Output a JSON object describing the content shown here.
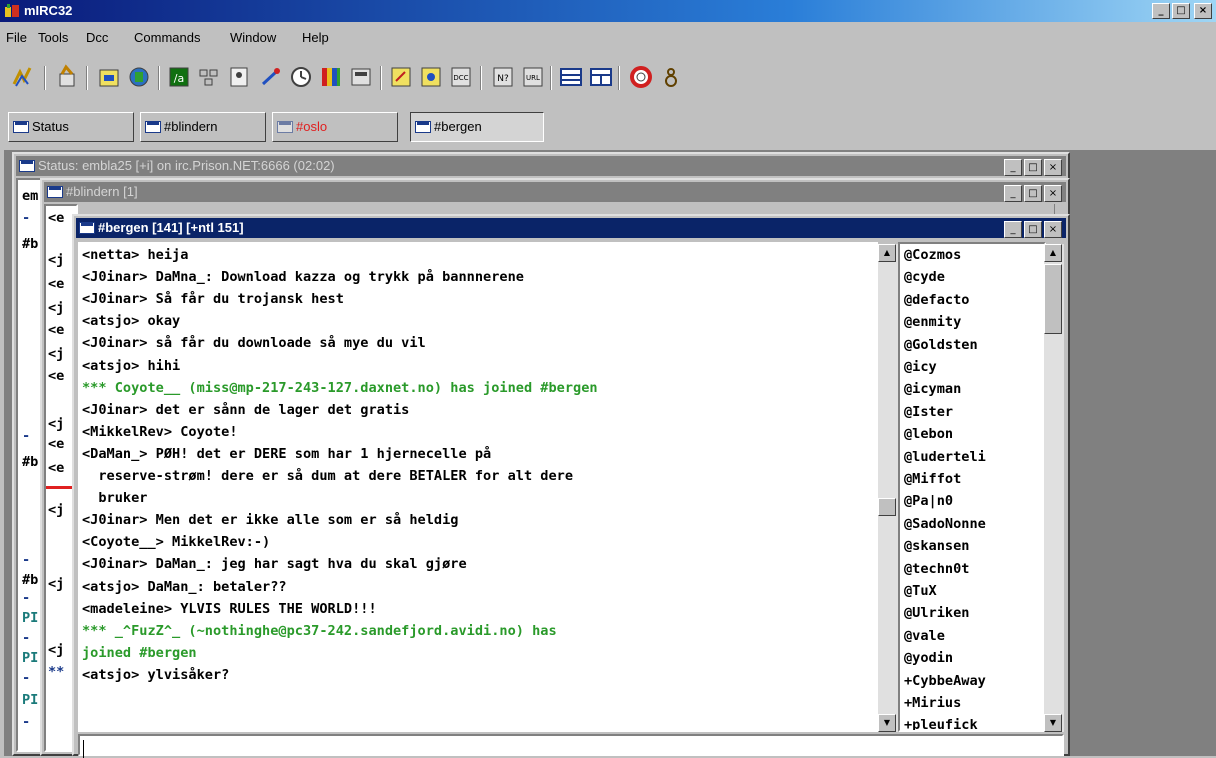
{
  "app": {
    "title": "mIRC32",
    "minimize": "_",
    "maximize": "□",
    "close": "×"
  },
  "menu": {
    "file": "File",
    "tools": "Tools",
    "dcc": "Dcc",
    "commands": "Commands",
    "window": "Window",
    "help": "Help"
  },
  "toolbar": {
    "icons": [
      "connect-icon",
      "options-icon",
      "channels-folder-icon",
      "server-list-icon",
      "scripts-editor-icon",
      "remote-icon",
      "address-book-icon",
      "ping-icon",
      "timer-icon",
      "colors-icon",
      "notify-icon",
      "dcc-send-icon",
      "dcc-chat-icon",
      "dcc-options-icon",
      "about-icon",
      "url-list-icon",
      "tile-icon",
      "cascade-icon",
      "help-icon",
      "user-icon"
    ]
  },
  "switchbar": {
    "status": "Status",
    "blindern": "#blindern",
    "oslo": "#oslo",
    "bergen": "#bergen"
  },
  "status_window": {
    "title": "Status: embla25 [+i] on irc.Prison.NET:6666 (02:02)",
    "visible_lines": [
      "em",
      "-",
      "#b",
      "-",
      "#b",
      "-",
      "#b",
      "-",
      "PI",
      "-",
      "PI",
      "-",
      "PI",
      "-"
    ]
  },
  "blindern_window": {
    "title": "#blindern [1]",
    "visible_lines": [
      "<e",
      "<j",
      "<e",
      "<j",
      "<e",
      "<j",
      "<e",
      "<j",
      "<e",
      "<e",
      "<j",
      "<j",
      "<j",
      "**"
    ]
  },
  "bergen_window": {
    "title": "#bergen [141] [+ntl 151]",
    "colors": {
      "text": "#000000",
      "join": "#2a9a2a",
      "title_bg": "#0a2468"
    },
    "messages": [
      {
        "text": "<netta> heija",
        "kind": "msg"
      },
      {
        "text": "<J0inar> DaMna_: Download kazza og trykk på bannnerene",
        "kind": "msg"
      },
      {
        "text": "<J0inar> Så får du trojansk hest",
        "kind": "msg"
      },
      {
        "text": "<atsjo> okay",
        "kind": "msg"
      },
      {
        "text": "<J0inar> så får du downloade så mye du vil",
        "kind": "msg"
      },
      {
        "text": "<atsjo> hihi",
        "kind": "msg"
      },
      {
        "text": "*** Coyote__ (miss@mp-217-243-127.daxnet.no) has joined #bergen",
        "kind": "join"
      },
      {
        "text": "<J0inar> det er sånn de lager det gratis",
        "kind": "msg"
      },
      {
        "text": "<MikkelRev> Coyote!",
        "kind": "msg"
      },
      {
        "text": "<DaMan_> PØH! det er DERE som har 1 hjernecelle på",
        "kind": "msg"
      },
      {
        "text": "  reserve-strøm! dere er så dum at dere BETALER for alt dere",
        "kind": "msg"
      },
      {
        "text": "  bruker",
        "kind": "msg"
      },
      {
        "text": "<J0inar> Men det er ikke alle som er så heldig",
        "kind": "msg"
      },
      {
        "text": "<Coyote__> MikkelRev:-)",
        "kind": "msg"
      },
      {
        "text": "<J0inar> DaMan_: jeg har sagt hva du skal gjøre",
        "kind": "msg"
      },
      {
        "text": "<atsjo> DaMan_: betaler??",
        "kind": "msg"
      },
      {
        "text": "<madeleine> YLVIS RULES THE WORLD!!!",
        "kind": "msg"
      },
      {
        "text": "*** _^FuzZ^_ (~nothinghe@pc37-242.sandefjord.avidi.no) has",
        "kind": "join"
      },
      {
        "text": "joined #bergen",
        "kind": "join"
      },
      {
        "text": "<atsjo> ylvisåker?",
        "kind": "msg"
      }
    ],
    "nicks": [
      "@Cozmos",
      "@cyde",
      "@defacto",
      "@enmity",
      "@Goldsten",
      "@icy",
      "@icyman",
      "@Ister",
      "@lebon",
      "@luderteli",
      "@Miffot",
      "@Pa|n0",
      "@SadoNonne",
      "@skansen",
      "@techn0t",
      "@TuX",
      "@Ulriken",
      "@vale",
      "@yodin",
      "+CybbeAway",
      "+Mirius",
      "+pleufick"
    ],
    "input_value": ""
  }
}
